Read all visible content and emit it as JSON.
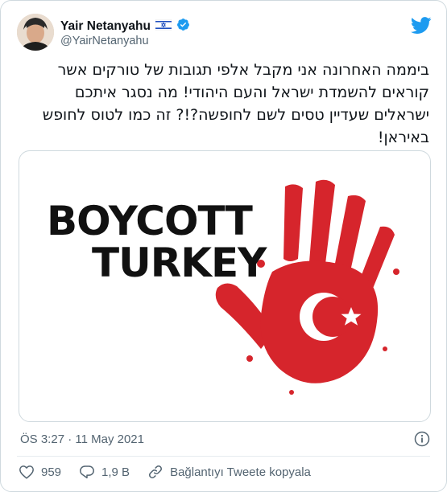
{
  "author": {
    "name": "Yair Netanyahu",
    "handle": "@YairNetanyahu"
  },
  "tweet": {
    "text": "ביממה האחרונה אני מקבל אלפי תגובות של טורקים אשר קוראים להשמדת ישראל והעם היהודי! מה נסגר איתכם ישראלים שעדיין טסים לשם לחופשה?!? זה כמו לטוס לחופש באיראן!"
  },
  "media": {
    "line1": "BOYCOTT",
    "line2": "TURKEY"
  },
  "meta": {
    "timestamp": "ÖS 3:27 · 11 May 2021"
  },
  "actions": {
    "likes": "959",
    "replies": "1,9 B",
    "copy_link": "Bağlantıyı Tweete kopyala"
  },
  "colors": {
    "twitter_blue": "#1d9bf0",
    "hand_red": "#d6252c",
    "muted_text": "#536471"
  }
}
